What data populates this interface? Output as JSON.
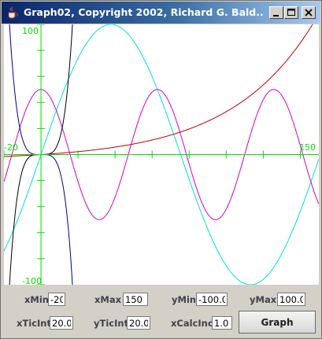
{
  "window": {
    "title": "Graph02, Copyright 2002, Richard G. Bald..."
  },
  "graph": {
    "y_max_label": "100",
    "y_min_label": "-100",
    "x_min_label": "-20",
    "x_max_label": "150"
  },
  "controls": {
    "xmin_label": "xMin",
    "xmin_value": "-20",
    "xmax_label": "xMax",
    "xmax_value": "150",
    "ymin_label": "yMin",
    "ymin_value": "-100.0",
    "ymax_label": "yMax",
    "ymax_value": "100.0",
    "xticint_label": "xTicInt",
    "xticint_value": "20.0",
    "yticint_label": "yTicInt",
    "yticint_value": "20.0",
    "xcalcinc_label": "xCalcInc",
    "xcalcinc_value": "1.0",
    "graph_button": "Graph"
  },
  "colors": {
    "axis": "#00e000",
    "cyan_curve": "#00e0e0",
    "magenta_curve": "#d000d0",
    "red_curve": "#c00000",
    "black_curve": "#000000",
    "navy_curve": "#000090"
  }
}
